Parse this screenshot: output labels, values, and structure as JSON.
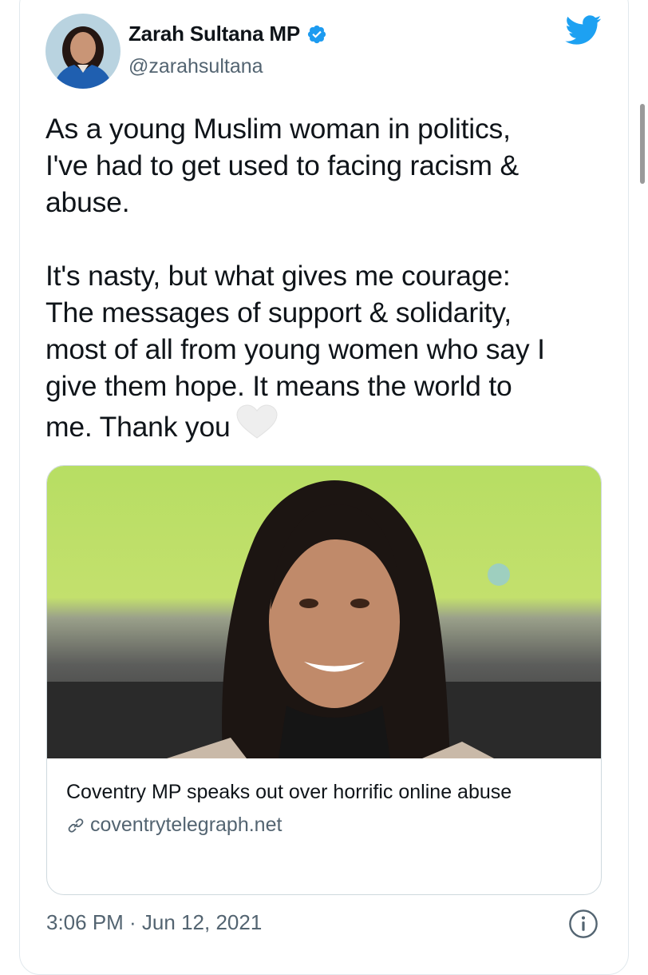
{
  "tweet": {
    "author_name": "Zarah Sultana MP",
    "author_handle": "@zarahsultana",
    "text_paragraph_1": "As a young Muslim woman in politics,\nI've had to get used to facing racism &\nabuse.",
    "text_paragraph_2": "It's nasty, but what gives me courage:\nThe messages of support & solidarity,\nmost of all from young women who say I\ngive them hope. It means the world to\nme. Thank you",
    "emoji": "white-heart",
    "timestamp": "3:06 PM · Jun 12, 2021"
  },
  "link_card": {
    "title": "Coventry MP speaks out over horrific online abuse",
    "domain": "coventrytelegraph.net"
  },
  "icons": {
    "verified": "verified-badge-icon",
    "twitter": "twitter-bird-icon",
    "link": "link-icon",
    "info": "info-icon"
  },
  "colors": {
    "verified_blue": "#1d9bf0",
    "twitter_blue": "#1da1f2",
    "secondary_text": "#536471",
    "border": "#cfd9de"
  }
}
